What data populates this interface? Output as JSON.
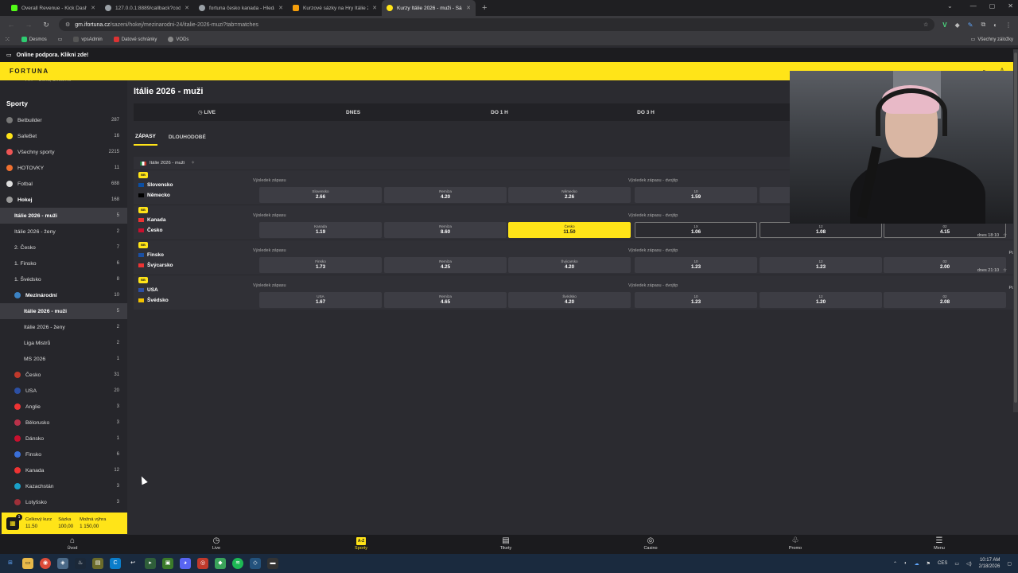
{
  "browser": {
    "tabs": [
      {
        "title": "Overall Revenue - Kick Dashbo",
        "color": "#53fc18"
      },
      {
        "title": "127.0.0.1:8889/callback?code=",
        "color": "#9aa0a6"
      },
      {
        "title": "fortuna česko kanada - Hledat",
        "color": "#9aa0a6"
      },
      {
        "title": "Kurzové sázky na Hry Itálie 202",
        "color": "#f59e0b"
      },
      {
        "title": "Kurzy Itálie 2026 - muži - Sázo",
        "color": "#ffe418"
      }
    ],
    "url_host": "gm.ifortuna.cz",
    "url_path": "/sazeni/hokej/mezinarodni-24/italie-2026-muzi?tab=matches",
    "bookmarks": [
      "Desmos",
      "",
      "vpsAdmin",
      "Datové schránky",
      "VODs"
    ],
    "bookmarks_right": "Všechny záložky"
  },
  "support": {
    "text": "Online podpora. Klikni zde!"
  },
  "brand": "FORTUNA",
  "sidebar": {
    "cut_text": "ATP - Dohá, Dvouhra",
    "heading": "Sporty",
    "items": [
      {
        "label": "Betbuilder",
        "count": "287",
        "icon": "#777"
      },
      {
        "label": "SafeBet",
        "count": "16",
        "icon": "#ffe418"
      },
      {
        "label": "Všechny sporty",
        "count": "2215",
        "icon": "#e55"
      },
      {
        "label": "HOTOVKY",
        "count": "11",
        "icon": "#f07030"
      },
      {
        "label": "Fotbal",
        "count": "688",
        "icon": "#ddd"
      },
      {
        "label": "Hokej",
        "count": "168",
        "icon": "#999"
      },
      {
        "label": "Itálie 2026 - muži",
        "count": "5",
        "icon": ""
      },
      {
        "label": "Itálie 2026 - ženy",
        "count": "2",
        "icon": ""
      },
      {
        "label": "2. Česko",
        "count": "7",
        "icon": ""
      },
      {
        "label": "1. Finsko",
        "count": "6",
        "icon": ""
      },
      {
        "label": "1. Švédsko",
        "count": "8",
        "icon": ""
      },
      {
        "label": "Mezinárodní",
        "count": "10",
        "icon": "#3b82c4"
      },
      {
        "label": "Itálie 2026 - muži",
        "count": "5",
        "icon": ""
      },
      {
        "label": "Itálie 2026 - ženy",
        "count": "2",
        "icon": ""
      },
      {
        "label": "Liga Mistrů",
        "count": "2",
        "icon": ""
      },
      {
        "label": "MS 2026",
        "count": "1",
        "icon": ""
      },
      {
        "label": "Česko",
        "count": "31",
        "icon": "#c0392b"
      },
      {
        "label": "USA",
        "count": "20",
        "icon": "#2c4fa3"
      },
      {
        "label": "Anglie",
        "count": "3",
        "icon": "#e33"
      },
      {
        "label": "Bělorusko",
        "count": "3",
        "icon": "#b9324a"
      },
      {
        "label": "Dánsko",
        "count": "1",
        "icon": "#c8102e"
      },
      {
        "label": "Finsko",
        "count": "6",
        "icon": "#3a6fd8"
      },
      {
        "label": "Kanada",
        "count": "12",
        "icon": "#e33"
      },
      {
        "label": "Kazachstán",
        "count": "3",
        "icon": "#1aa0c8"
      },
      {
        "label": "Lotyšsko",
        "count": "3",
        "icon": "#9e3039"
      }
    ]
  },
  "betslip": {
    "badge": "1",
    "total_odds_label": "Celkový kurz",
    "total_odds": "11.50",
    "stake_label": "Sázka",
    "stake": "100,00",
    "win_label": "Možná výhra",
    "win": "1 150,00"
  },
  "main": {
    "title": "Itálie 2026 - muži",
    "filters": [
      "LIVE",
      "DNES",
      "DO 1 H",
      "DO 3 H",
      "ZÍ"
    ],
    "subtabs": [
      "ZÁPASY",
      "DLOUHODOBÉ"
    ],
    "league": "Itálie 2026 - muži",
    "market1": "Výsledek zápasu",
    "market2": "Výsledek zápasu - dvojtip",
    "bb_label": "BB",
    "matches": [
      {
        "home": "Slovensko",
        "away": "Německo",
        "time": "",
        "poc": "",
        "odds": [
          {
            "n": "Slovensko",
            "v": "2.66"
          },
          {
            "n": "Remíza",
            "v": "4.20"
          },
          {
            "n": "Německo",
            "v": "2.26"
          },
          {
            "n": "10",
            "v": "1.59"
          },
          {
            "n": "",
            "v": ""
          },
          {
            "n": "",
            "v": ""
          }
        ]
      },
      {
        "home": "Kanada",
        "away": "Česko",
        "time": "",
        "poc": "",
        "odds": [
          {
            "n": "Kanada",
            "v": "1.19"
          },
          {
            "n": "Remíza",
            "v": "8.60"
          },
          {
            "n": "Česko",
            "v": "11.50"
          },
          {
            "n": "1X",
            "v": "1.06"
          },
          {
            "n": "12",
            "v": "1.08"
          },
          {
            "n": "02",
            "v": "4.15"
          }
        ]
      },
      {
        "home": "Finsko",
        "away": "Švýcarsko",
        "time": "dnes 18:10",
        "poc": "Poč",
        "odds": [
          {
            "n": "Finsko",
            "v": "1.73"
          },
          {
            "n": "Remíza",
            "v": "4.25"
          },
          {
            "n": "Švýcarsko",
            "v": "4.20"
          },
          {
            "n": "10",
            "v": "1.23"
          },
          {
            "n": "12",
            "v": "1.23"
          },
          {
            "n": "02",
            "v": "2.00"
          }
        ]
      },
      {
        "home": "USA",
        "away": "Švédsko",
        "time": "dnes 21:10",
        "poc": "Poč",
        "odds": [
          {
            "n": "USA",
            "v": "1.67"
          },
          {
            "n": "Remíza",
            "v": "4.65"
          },
          {
            "n": "Švédsko",
            "v": "4.20"
          },
          {
            "n": "10",
            "v": "1.23"
          },
          {
            "n": "12",
            "v": "1.20"
          },
          {
            "n": "02",
            "v": "2.08"
          }
        ]
      }
    ]
  },
  "bottomnav": [
    {
      "label": "Úvod",
      "icon": "⌂"
    },
    {
      "label": "Live",
      "icon": "◷"
    },
    {
      "label": "Sporty",
      "icon": "A-Z"
    },
    {
      "label": "Tikety",
      "icon": "▤"
    },
    {
      "label": "Casino",
      "icon": "◎"
    },
    {
      "label": "Promo",
      "icon": "♧"
    },
    {
      "label": "Menu",
      "icon": "☰"
    }
  ],
  "taskbar": {
    "lang": "CES",
    "time": "10:17 AM",
    "date": "2/18/2026"
  }
}
